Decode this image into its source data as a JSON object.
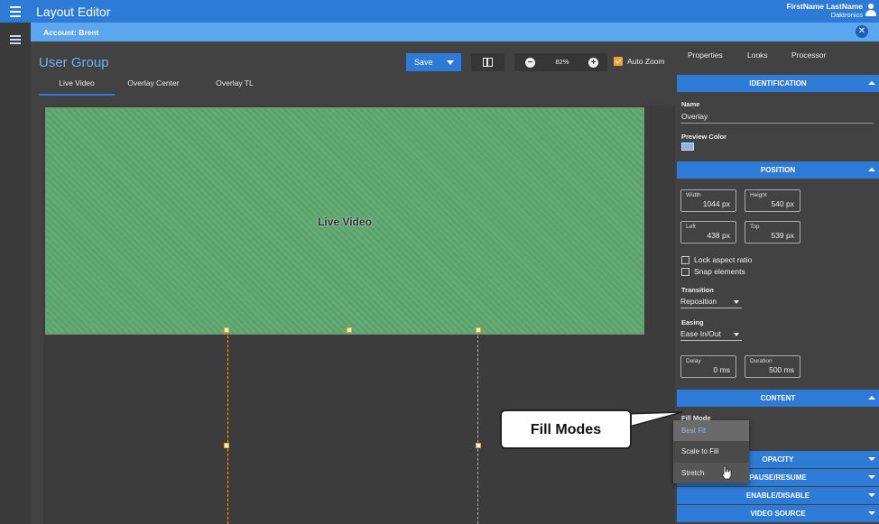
{
  "app": {
    "title": "Layout Editor"
  },
  "user": {
    "name": "FirstName LastName",
    "org": "Daktronics"
  },
  "account": {
    "label": "Account: Brent"
  },
  "main": {
    "group_title": "User Group",
    "save_label": "Save",
    "zoom_value": "82%",
    "auto_zoom_label": "Auto Zoom",
    "auto_zoom_checked": true,
    "tabs": [
      {
        "label": "Live Video",
        "active": true
      },
      {
        "label": "Overlay Center"
      },
      {
        "label": "Overlay TL"
      }
    ],
    "canvas_label": "Live Video",
    "canvas_color": "#62ab74"
  },
  "panel": {
    "tabs": [
      "Properties",
      "Looks",
      "Processor"
    ],
    "identification": {
      "header": "IDENTIFICATION",
      "name_label": "Name",
      "name_value": "Overlay",
      "preview_label": "Preview Color",
      "preview_color": "#8fb3de"
    },
    "position": {
      "header": "POSITION",
      "width_label": "Width",
      "width_value": "1044",
      "width_unit": "px",
      "height_label": "Height",
      "height_value": "540",
      "height_unit": "px",
      "left_label": "Left",
      "left_value": "438",
      "left_unit": "px",
      "top_label": "Top",
      "top_value": "539",
      "top_unit": "px",
      "lock_label": "Lock aspect ratio",
      "snap_label": "Snap elements",
      "transition_label": "Transition",
      "transition_value": "Reposition",
      "easing_label": "Easing",
      "easing_value": "Ease In/Out",
      "delay_label": "Delay",
      "delay_value": "0",
      "delay_unit": "ms",
      "duration_label": "Duration",
      "duration_value": "500",
      "duration_unit": "ms"
    },
    "content": {
      "header": "CONTENT",
      "fill_mode_label": "Fill Mode",
      "fill_options": [
        "Best Fit",
        "Scale to Fill",
        "Stretch"
      ],
      "fill_selected": "Best Fit"
    },
    "collapsed_sections": [
      "OPACITY",
      "PAUSE/RESUME",
      "ENABLE/DISABLE",
      "VIDEO SOURCE"
    ]
  },
  "callout": {
    "text": "Fill Modes"
  },
  "colors": {
    "accent": "#2d7bd6",
    "account_bar": "#5aa6ef",
    "handle": "#f0a030"
  }
}
